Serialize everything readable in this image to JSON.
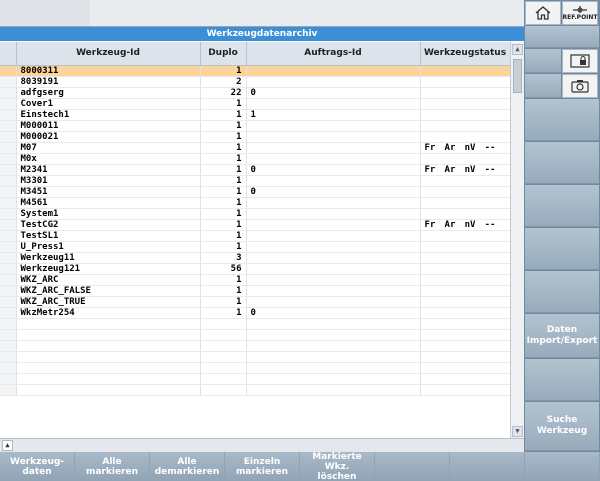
{
  "title": "Werkzeugdatenarchiv",
  "columns": {
    "tool_id": "Werkzeug-Id",
    "duplo": "Duplo",
    "order_id": "Auftrags-Id",
    "status": "Werkzeugstatus"
  },
  "rows": [
    {
      "tool": "8000311",
      "duplo": "1",
      "order": "",
      "status": []
    },
    {
      "tool": "8039191",
      "duplo": "2",
      "order": "",
      "status": []
    },
    {
      "tool": "adfgserg",
      "duplo": "22",
      "order": "0",
      "status": []
    },
    {
      "tool": "Cover1",
      "duplo": "1",
      "order": "",
      "status": []
    },
    {
      "tool": "Einstech1",
      "duplo": "1",
      "order": "1",
      "status": []
    },
    {
      "tool": "M000011",
      "duplo": "1",
      "order": "",
      "status": []
    },
    {
      "tool": "M000021",
      "duplo": "1",
      "order": "",
      "status": []
    },
    {
      "tool": "M07",
      "duplo": "1",
      "order": "",
      "status": [
        "Fr",
        "Ar",
        "nV",
        "--"
      ]
    },
    {
      "tool": "M0x",
      "duplo": "1",
      "order": "",
      "status": []
    },
    {
      "tool": "M2341",
      "duplo": "1",
      "order": "0",
      "status": [
        "Fr",
        "Ar",
        "nV",
        "--"
      ]
    },
    {
      "tool": "M3301",
      "duplo": "1",
      "order": "",
      "status": []
    },
    {
      "tool": "M3451",
      "duplo": "1",
      "order": "0",
      "status": []
    },
    {
      "tool": "M4561",
      "duplo": "1",
      "order": "",
      "status": []
    },
    {
      "tool": "System1",
      "duplo": "1",
      "order": "",
      "status": []
    },
    {
      "tool": "TestCG2",
      "duplo": "1",
      "order": "",
      "status": [
        "Fr",
        "Ar",
        "nV",
        "--"
      ]
    },
    {
      "tool": "TestSL1",
      "duplo": "1",
      "order": "",
      "status": []
    },
    {
      "tool": "U_Press1",
      "duplo": "1",
      "order": "",
      "status": []
    },
    {
      "tool": "Werkzeug11",
      "duplo": "3",
      "order": "",
      "status": []
    },
    {
      "tool": "Werkzeug121",
      "duplo": "56",
      "order": "",
      "status": []
    },
    {
      "tool": "WKZ_ARC",
      "duplo": "1",
      "order": "",
      "status": []
    },
    {
      "tool": "WKZ_ARC_FALSE",
      "duplo": "1",
      "order": "",
      "status": []
    },
    {
      "tool": "WKZ_ARC_TRUE",
      "duplo": "1",
      "order": "",
      "status": []
    },
    {
      "tool": "WkzMetr254",
      "duplo": "1",
      "order": "0",
      "status": []
    }
  ],
  "selected_row_index": 0,
  "empty_row_count": 7,
  "horizontal_softkeys": [
    "Werkzeug-\ndaten",
    "Alle markieren",
    "Alle\ndemarkieren",
    "Einzeln\nmarkieren",
    "Markierte Wkz.\nlöschen",
    "",
    "",
    ""
  ],
  "vertical_softkeys": {
    "refpoint_label": "REF.POINT",
    "data_import_export": "Daten\nImport/Export",
    "search_tool": "Suche\nWerkzeug"
  },
  "colors": {
    "title_bar": "#3a8fd6",
    "selected_row": "#fcd39a",
    "softkey": "#a9bac8"
  }
}
